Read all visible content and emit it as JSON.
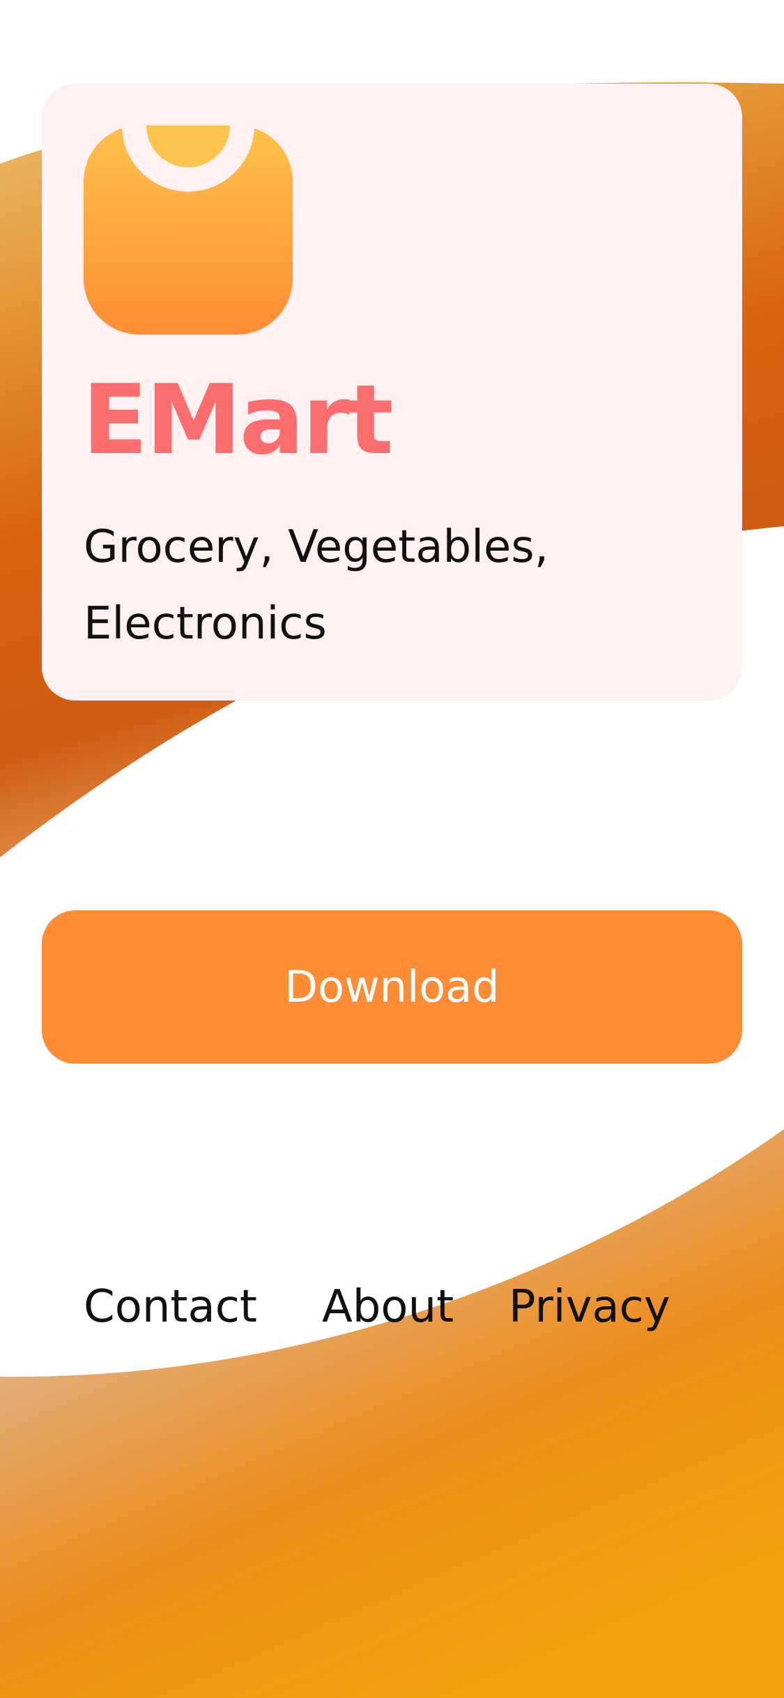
{
  "app": {
    "name": "EMart",
    "tagline": "Grocery, Vegetables, Electronics",
    "icon": "shopping-bag-icon"
  },
  "actions": {
    "download_label": "Download"
  },
  "footer": {
    "links": [
      {
        "label": "Contact"
      },
      {
        "label": "About"
      },
      {
        "label": "Privacy"
      }
    ]
  },
  "colors": {
    "title": "#fc6e6e",
    "button": "#fe8c35",
    "card": "#fff1f2",
    "icon_gradient_top": "#ffc24a",
    "icon_gradient_bottom": "#ff8d34",
    "background_accent": "#f0900f"
  }
}
